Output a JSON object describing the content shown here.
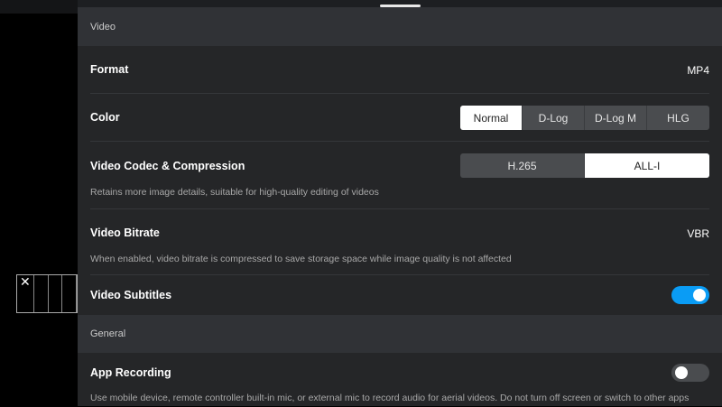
{
  "sections": {
    "video": "Video",
    "general": "General"
  },
  "format": {
    "label": "Format",
    "value": "MP4"
  },
  "color": {
    "label": "Color",
    "options": [
      "Normal",
      "D-Log",
      "D-Log M",
      "HLG"
    ],
    "selected": "Normal"
  },
  "codec": {
    "label": "Video Codec & Compression",
    "options": [
      "H.265",
      "ALL-I"
    ],
    "selected": "ALL-I",
    "description": "Retains more image details, suitable for high-quality editing of videos"
  },
  "bitrate": {
    "label": "Video Bitrate",
    "value": "VBR",
    "description": "When enabled, video bitrate is compressed to save storage space while image quality is not affected"
  },
  "subtitles": {
    "label": "Video Subtitles",
    "enabled": true
  },
  "app_recording": {
    "label": "App Recording",
    "enabled": false,
    "description": "Use mobile device, remote controller built-in mic, or external mic to record audio for aerial videos. Do not turn off screen or switch to other apps"
  },
  "grid_close": "✕",
  "colors": {
    "accent": "#0a9cf5",
    "toggle_off": "#4a4c4f"
  }
}
